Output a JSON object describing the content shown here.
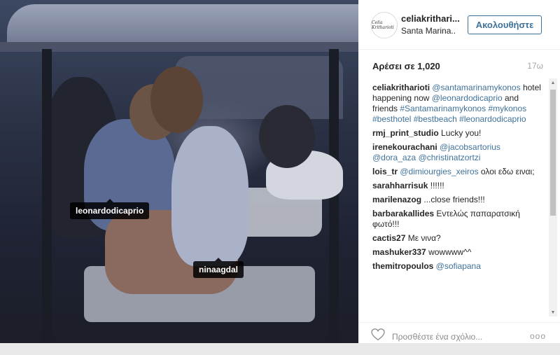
{
  "post": {
    "username": "celiakrithari...",
    "location": "Santa Marina..",
    "follow_label": "Ακολουθήστε",
    "likes": "Αρέσει σε 1,020",
    "time": "17ω",
    "avatar_text": "Celia Kritharioti"
  },
  "photo_tags": [
    {
      "label": "leonardodicaprio"
    },
    {
      "label": "ninaagdal"
    }
  ],
  "caption": {
    "user": "celiakritharioti",
    "parts": [
      {
        "text": "@santamarinamykonos",
        "link": true
      },
      {
        "text": " hotel happening now ",
        "link": false
      },
      {
        "text": "@leonardodicaprio",
        "link": true
      },
      {
        "text": " and friends ",
        "link": false
      },
      {
        "text": "#Santamarinamykonos",
        "link": true
      },
      {
        "text": " ",
        "link": false
      },
      {
        "text": "#mykonos",
        "link": true
      },
      {
        "text": " ",
        "link": false
      },
      {
        "text": "#besthotel",
        "link": true
      },
      {
        "text": " ",
        "link": false
      },
      {
        "text": "#bestbeach",
        "link": true
      },
      {
        "text": " ",
        "link": false
      },
      {
        "text": "#leonardodicaprio",
        "link": true
      }
    ]
  },
  "comments": [
    {
      "user": "rmj_print_studio",
      "parts": [
        {
          "text": "Lucky you!",
          "link": false
        }
      ]
    },
    {
      "user": "irenekourachani",
      "parts": [
        {
          "text": "@jacobsartorius",
          "link": true
        },
        {
          "text": " ",
          "link": false
        },
        {
          "text": "@dora_aza",
          "link": true
        },
        {
          "text": " ",
          "link": false
        },
        {
          "text": "@christinatzortzi",
          "link": true
        }
      ]
    },
    {
      "user": "lois_tr",
      "parts": [
        {
          "text": "@dimiourgies_xeiros",
          "link": true
        },
        {
          "text": " ολοι εδω ειναι;",
          "link": false
        }
      ]
    },
    {
      "user": "sarahharrisuk",
      "parts": [
        {
          "text": "!!!!!!",
          "link": false
        }
      ]
    },
    {
      "user": "marilenazog",
      "parts": [
        {
          "text": "...close friends!!!",
          "link": false
        }
      ]
    },
    {
      "user": "barbarakallides",
      "parts": [
        {
          "text": "Εντελώς παπαρατσική φωτό!!!",
          "link": false
        }
      ]
    },
    {
      "user": "cactis27",
      "parts": [
        {
          "text": "Με νινα?",
          "link": false
        }
      ]
    },
    {
      "user": "mashuker337",
      "parts": [
        {
          "text": "wowwww^^",
          "link": false
        }
      ]
    },
    {
      "user": "themitropoulos",
      "parts": [
        {
          "text": "@sofiapana",
          "link": true
        }
      ]
    }
  ],
  "add_comment_placeholder": "Προσθέστε ένα σχόλιο...",
  "more_label": "ooo",
  "colors": {
    "link": "#3f729b",
    "text": "#262626",
    "muted": "#a5a7aa"
  },
  "icons": {
    "like": "heart-icon",
    "more": "more-options-icon"
  }
}
